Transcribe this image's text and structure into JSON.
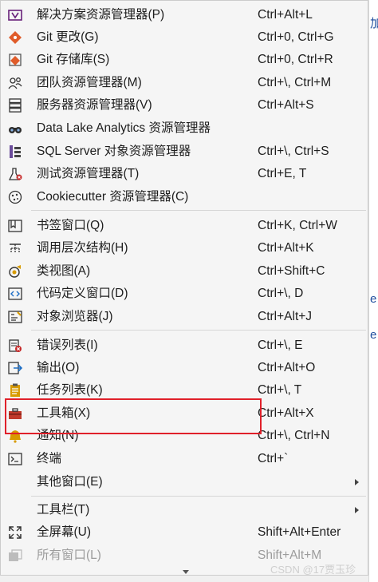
{
  "menu": {
    "items": [
      {
        "label": "解决方案资源管理器(P)",
        "shortcut": "Ctrl+Alt+L"
      },
      {
        "label": "Git 更改(G)",
        "shortcut": "Ctrl+0, Ctrl+G"
      },
      {
        "label": "Git 存储库(S)",
        "shortcut": "Ctrl+0, Ctrl+R"
      },
      {
        "label": "团队资源管理器(M)",
        "shortcut": "Ctrl+\\, Ctrl+M"
      },
      {
        "label": "服务器资源管理器(V)",
        "shortcut": "Ctrl+Alt+S"
      },
      {
        "label": "Data Lake Analytics 资源管理器",
        "shortcut": ""
      },
      {
        "label": "SQL Server 对象资源管理器",
        "shortcut": "Ctrl+\\, Ctrl+S"
      },
      {
        "label": "测试资源管理器(T)",
        "shortcut": "Ctrl+E, T"
      },
      {
        "label": "Cookiecutter 资源管理器(C)",
        "shortcut": ""
      },
      {
        "label": "书签窗口(Q)",
        "shortcut": "Ctrl+K, Ctrl+W"
      },
      {
        "label": "调用层次结构(H)",
        "shortcut": "Ctrl+Alt+K"
      },
      {
        "label": "类视图(A)",
        "shortcut": "Ctrl+Shift+C"
      },
      {
        "label": "代码定义窗口(D)",
        "shortcut": "Ctrl+\\, D"
      },
      {
        "label": "对象浏览器(J)",
        "shortcut": "Ctrl+Alt+J"
      },
      {
        "label": "错误列表(I)",
        "shortcut": "Ctrl+\\, E"
      },
      {
        "label": "输出(O)",
        "shortcut": "Ctrl+Alt+O"
      },
      {
        "label": "任务列表(K)",
        "shortcut": "Ctrl+\\, T"
      },
      {
        "label": "工具箱(X)",
        "shortcut": "Ctrl+Alt+X"
      },
      {
        "label": "通知(N)",
        "shortcut": "Ctrl+\\, Ctrl+N"
      },
      {
        "label": "终端",
        "shortcut": "Ctrl+`"
      },
      {
        "label": "其他窗口(E)",
        "shortcut": ""
      },
      {
        "label": "工具栏(T)",
        "shortcut": ""
      },
      {
        "label": "全屏幕(U)",
        "shortcut": "Shift+Alt+Enter"
      },
      {
        "label": "所有窗口(L)",
        "shortcut": "Shift+Alt+M"
      }
    ]
  },
  "background": {
    "edge_glyphs": [
      "加",
      "e",
      "e"
    ]
  },
  "watermark": "CSDN @17贾玉珍",
  "colors": {
    "highlight_border": "#e0202a",
    "menu_bg": "#f5f5f5",
    "text": "#1e1e1e",
    "disabled_text": "#9c9c9c"
  }
}
